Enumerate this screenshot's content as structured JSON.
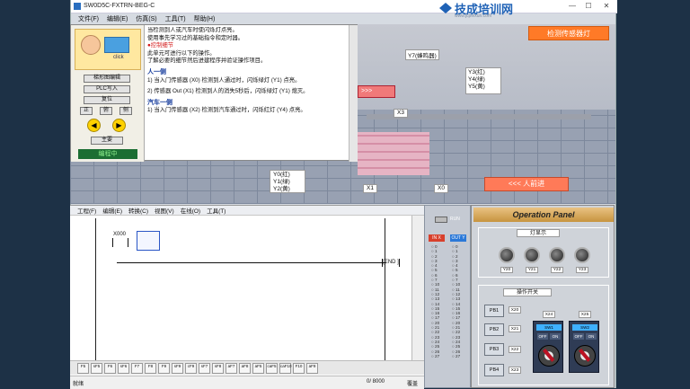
{
  "window": {
    "title": "SW0D5C-FXTRN-BEG-C",
    "brand": "技成培训网",
    "brand_url": "www.jcpeixun.com",
    "controls": [
      "—",
      "☐",
      "✕"
    ]
  },
  "menu": [
    "文件(F)",
    "编辑(E)",
    "仿真(S)",
    "工具(T)",
    "帮助(H)"
  ],
  "sidebar": {
    "click": "click",
    "buttons": [
      "梯形图编辑",
      "PLC写入",
      "复位"
    ],
    "nav": [
      "正",
      "俯",
      "侧"
    ],
    "arrow_left": "◀",
    "arrow_right": "▶",
    "home": "主要",
    "mode": "编程中"
  },
  "help": {
    "lines": [
      {
        "t": "当检测到人或汽车时使闪烁灯点亮。",
        "c": ""
      },
      {
        "t": "使用事先学习过的基础指令和定时器。",
        "c": ""
      },
      {
        "t": "●控制细节",
        "c": "b"
      },
      {
        "t": "此单元可进行以下的操作。",
        "c": ""
      },
      {
        "t": "了解必要的细节然后进建程序并验证操作项目。",
        "c": ""
      },
      {
        "t": "人一侧",
        "c": "h"
      },
      {
        "t": "1) 当入门传感器 (X0) 检测到人通过时，闪烁绿灯 (Y1) 点亮。",
        "c": ""
      },
      {
        "t": "2) 传感器 Out (X1) 检测到人的消失5秒后，闪烁绿灯 (Y1) 熄灭。",
        "c": ""
      },
      {
        "t": "汽车一侧",
        "c": "h"
      },
      {
        "t": "1) 当入门传感器 (X2) 检测到汽车通过时，闪烁红灯 (Y4) 点亮。",
        "c": ""
      }
    ]
  },
  "scene": {
    "title": "检测传感器灯",
    "buzzer": "Y7(蜂鸣器)",
    "lights": [
      "Y3(红)",
      "Y4(绿)",
      "Y5(黄)"
    ],
    "redbar": ">>>",
    "x_labels": [
      "X3",
      "X1",
      "X0"
    ],
    "y_labels": [
      "Y0(红)",
      "Y1(绿)",
      "Y2(黄)"
    ],
    "walk": "<<<  人前进"
  },
  "editor": {
    "menu": [
      "工程(F)",
      "编辑(E)",
      "转换(C)",
      "视图(V)",
      "在线(O)",
      "工具(T)"
    ],
    "contact": "X000",
    "end": "[END ]",
    "keys": [
      "F5",
      "sF5",
      "F6",
      "sF6",
      "F7",
      "F8",
      "F9",
      "sF9",
      "cF9",
      "sF7",
      "sF8",
      "aF7",
      "aF8",
      "aF5",
      "caF5",
      "caF10",
      "F10",
      "aF9"
    ],
    "status_left": "就绪",
    "status_mid": "0/ 8000",
    "status_right": "覆盖"
  },
  "io": {
    "run": "RUN",
    "in": "IN X",
    "out": "OUT Y",
    "in_nums": [
      "0",
      "1",
      "2",
      "3",
      "4",
      "5",
      "6",
      "7",
      "10",
      "11",
      "12",
      "13",
      "14",
      "15",
      "16",
      "17",
      "20",
      "21",
      "22",
      "23",
      "24",
      "25",
      "26",
      "27"
    ],
    "out_nums": [
      "0",
      "1",
      "2",
      "3",
      "4",
      "5",
      "6",
      "7",
      "10",
      "11",
      "12",
      "13",
      "14",
      "15",
      "16",
      "17",
      "20",
      "21",
      "22",
      "23",
      "24",
      "25",
      "26",
      "27"
    ]
  },
  "op": {
    "title": "Operation Panel",
    "lamps_header": "灯显示",
    "lamps": [
      "Y20",
      "Y21",
      "Y22",
      "Y23"
    ],
    "switch_header": "操作开关",
    "pbs": [
      "PB1",
      "PB2",
      "PB3",
      "PB4"
    ],
    "pb_x": [
      "X20",
      "X21",
      "X22",
      "X23"
    ],
    "sw_x": [
      "X24",
      "X25"
    ],
    "sw_names": [
      "SW1",
      "SW2"
    ],
    "sw_off": "OFF",
    "sw_on": "ON"
  }
}
